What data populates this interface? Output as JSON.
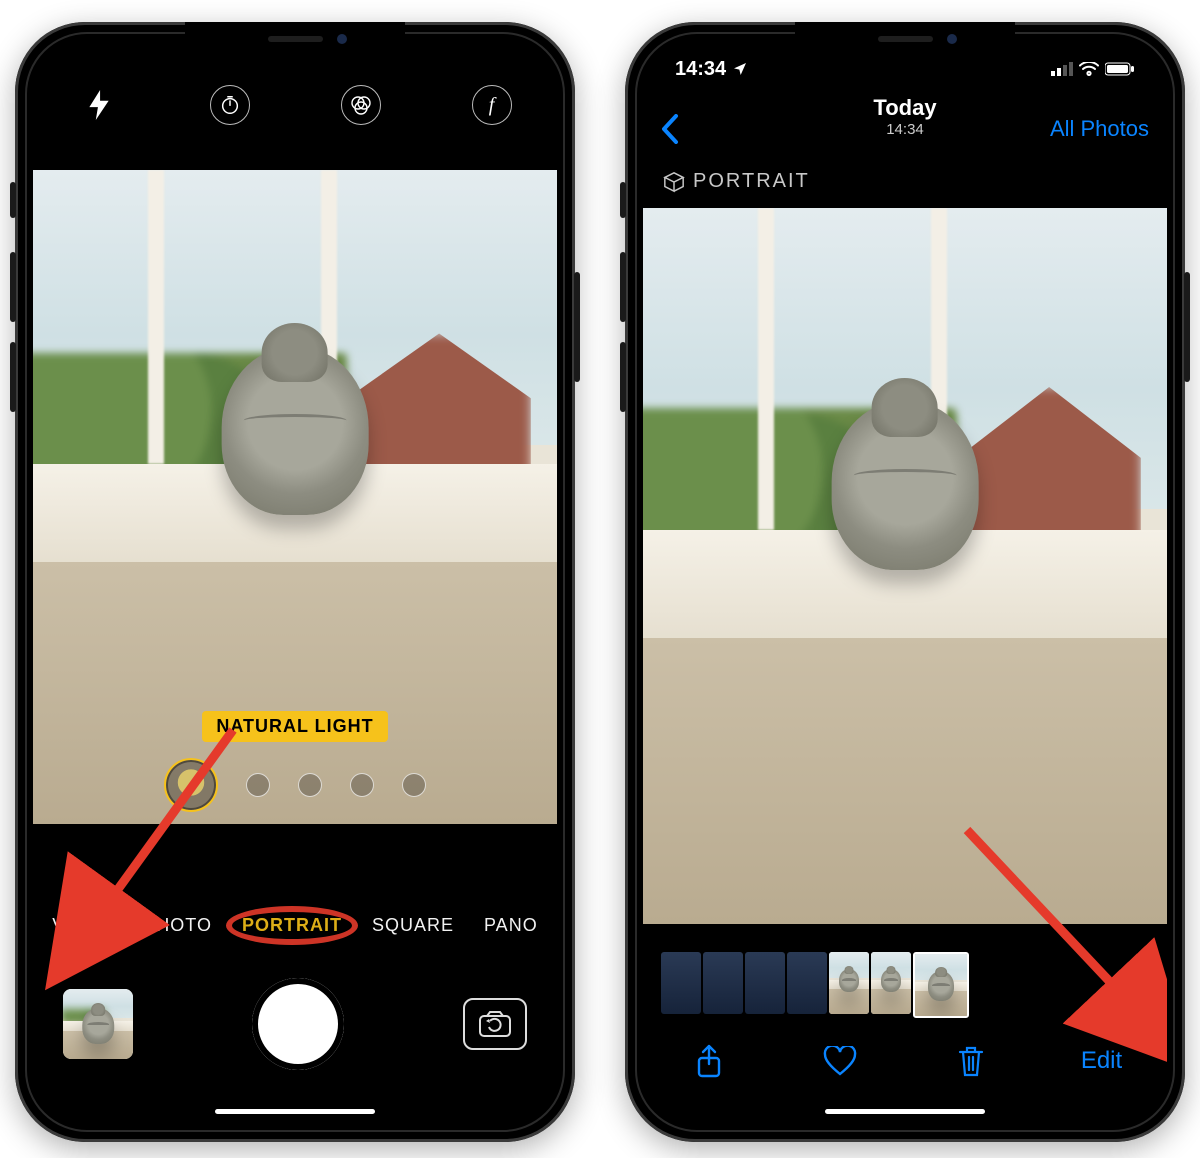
{
  "camera_app": {
    "top_controls": {
      "flash": "flash-auto",
      "timer": "timer",
      "filters": "filters",
      "depth": "f-stop"
    },
    "lighting_label": "NATURAL LIGHT",
    "modes": [
      "VIDEO",
      "PHOTO",
      "PORTRAIT",
      "SQUARE",
      "PANO"
    ],
    "selected_mode_index": 2
  },
  "photos_app": {
    "status": {
      "time": "14:34"
    },
    "nav": {
      "title": "Today",
      "subtitle": "14:34",
      "right_button": "All Photos"
    },
    "badge": "PORTRAIT",
    "toolbar": {
      "share": "share",
      "favorite": "favorite",
      "delete": "delete",
      "edit_label": "Edit"
    }
  },
  "colors": {
    "accent_yellow": "#f6c21b",
    "ios_blue": "#0a84ff",
    "annotation_red": "#e53a2b"
  }
}
